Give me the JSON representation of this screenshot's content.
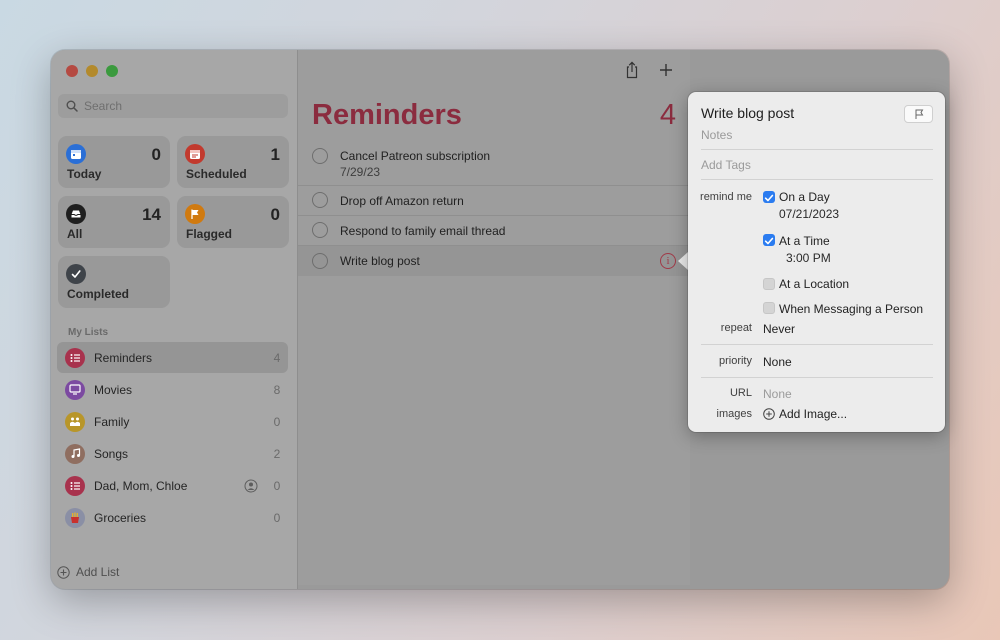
{
  "sidebar": {
    "search_placeholder": "Search",
    "smart_lists": [
      {
        "label": "Today",
        "count": "0",
        "icon": "calendar-icon",
        "color": "#2b6fd6"
      },
      {
        "label": "Scheduled",
        "count": "1",
        "icon": "calendar-clock-icon",
        "color": "#c23a2e"
      },
      {
        "label": "All",
        "count": "14",
        "icon": "tray-icon",
        "color": "#2a2a2a"
      },
      {
        "label": "Flagged",
        "count": "0",
        "icon": "flag-icon",
        "color": "#d07a10"
      },
      {
        "label": "Completed",
        "icon": "checkmark-icon",
        "color": "#4a4f55"
      }
    ],
    "my_lists_header": "My Lists",
    "lists": [
      {
        "name": "Reminders",
        "count": "4",
        "icon": "list-bullet-icon",
        "color": "#b93a55"
      },
      {
        "name": "Movies",
        "count": "8",
        "icon": "tv-icon",
        "color": "#8a4fb0"
      },
      {
        "name": "Family",
        "count": "0",
        "icon": "people-icon",
        "color": "#c9a227"
      },
      {
        "name": "Songs",
        "count": "2",
        "icon": "music-note-icon",
        "color": "#9b7464"
      },
      {
        "name": "Dad, Mom, Chloe",
        "count": "0",
        "icon": "list-bullet-icon",
        "color": "#b93a55"
      },
      {
        "name": "Groceries",
        "count": "0",
        "icon": "fries-icon",
        "color": "#8a8fa5"
      }
    ],
    "add_list_label": "Add List"
  },
  "main": {
    "title": "Reminders",
    "count": "4",
    "tasks": [
      {
        "title": "Cancel Patreon subscription",
        "date": "7/29/23"
      },
      {
        "title": "Drop off Amazon return"
      },
      {
        "title": "Respond to family email thread"
      },
      {
        "title": "Write blog post"
      }
    ],
    "accent_color": "#8b2c3f"
  },
  "detail": {
    "title": "Write blog post",
    "notes_placeholder": "Notes",
    "tags_placeholder": "Add Tags",
    "remind_me_label": "remind me",
    "on_a_day_label": "On a Day",
    "on_a_day_checked": true,
    "day_value": "07/21/2023",
    "at_a_time_label": "At a Time",
    "at_a_time_checked": true,
    "time_value": "3:00 PM",
    "at_a_location_label": "At a Location",
    "at_a_location_checked": false,
    "messaging_label": "When Messaging a Person",
    "messaging_checked": false,
    "repeat_label": "repeat",
    "repeat_value": "Never",
    "priority_label": "priority",
    "priority_value": "None",
    "url_label": "URL",
    "url_placeholder": "None",
    "images_label": "images",
    "add_image_label": "Add Image..."
  }
}
